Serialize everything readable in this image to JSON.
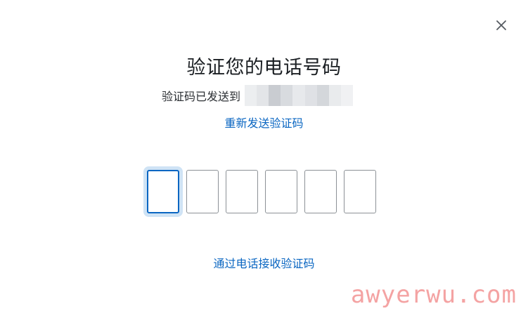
{
  "dialog": {
    "title": "验证您的电话号码",
    "sent_to_label": "验证码已发送到",
    "masked_phone_colors": [
      "#eceef0",
      "#e3e5e8",
      "#c9ccd1",
      "#d8dbdf",
      "#e7e9ec",
      "#dfe1e5",
      "#d4d7db",
      "#e9ebed",
      "#f0f1f3"
    ],
    "resend_link": "重新发送验证码",
    "call_link": "通过电话接收验证码",
    "otp": {
      "length": 6,
      "values": [
        "",
        "",
        "",
        "",
        "",
        ""
      ],
      "active_index": 0
    },
    "close_icon": "close-icon"
  },
  "colors": {
    "accent": "#0a66c2",
    "focus_ring": "#cfe3f5",
    "box_border": "#8c9196"
  },
  "watermark": "awyerwu.com"
}
